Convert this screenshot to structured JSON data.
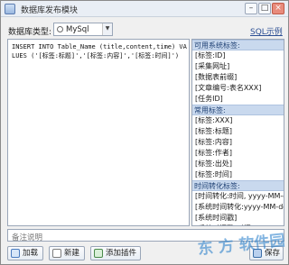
{
  "window": {
    "title": "数据库发布模块",
    "controls": {
      "minimize": "–",
      "maximize": "□",
      "close": "×"
    }
  },
  "db_type": {
    "label": "数据库类型:",
    "selected": "MySql"
  },
  "sql_example_link": "SQL示例",
  "editor": {
    "text": "INSERT INTO Table_Name (title,content,time) VALUES ('[标签:标题]','[标签:内容]','[标签:时间]')"
  },
  "tag_groups": [
    {
      "header": "可用系统标签:",
      "items": [
        "[标签:ID]",
        "[采集网址]",
        "[数据表前缀]",
        "[文章编号:表名XXX]",
        "[任务ID]"
      ]
    },
    {
      "header": "常用标签:",
      "items": [
        "[标签:XXX]",
        "[标签:标题]",
        "[标签:内容]",
        "[标签:作者]",
        "[标签:出处]",
        "[标签:时间]"
      ]
    },
    {
      "header": "时间转化标签:",
      "items": [
        "[时间转化:时间, yyyy-MM-dd]",
        "[系统时间转化:yyyy-MM-dd]",
        "[系统时间戳]",
        "[系统时间戳:时间]"
      ]
    }
  ],
  "remark": {
    "placeholder": "备注说明"
  },
  "buttons": {
    "load": "加载",
    "new": "新建",
    "add_plugin": "添加插件",
    "save": "保存"
  },
  "watermark": "东 方 软件园"
}
